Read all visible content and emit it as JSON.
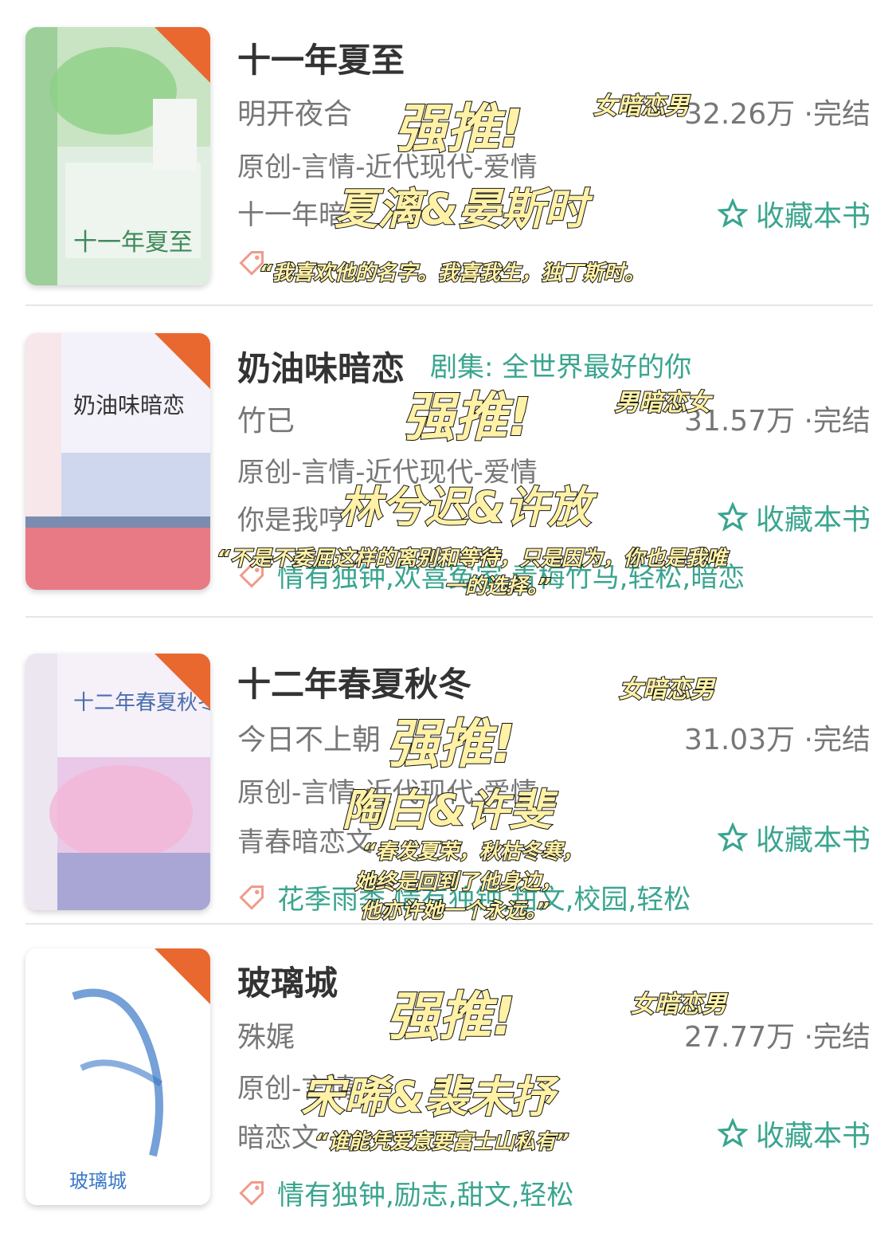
{
  "books": [
    {
      "title": "十一年夏至",
      "author": "明开夜合",
      "stats": "32.26万 ·完结",
      "genre": "原创-言情-近代现代-爱情",
      "intro": "十一年暗",
      "fav_label": "收藏本书",
      "badge": "完结",
      "cover_text": "十一年夏至"
    },
    {
      "title": "奶油味暗恋",
      "drama": "剧集: 全世界最好的你",
      "author": "竹已",
      "stats": "31.57万 ·完结",
      "genre": "原创-言情-近代现代-爱情",
      "intro": "你是我哼",
      "fav_label": "收藏本书",
      "tags": "情有独钟,欢喜冤家,青梅竹马,轻松,暗恋",
      "badge": "完结",
      "cover_text": "奶油味暗恋"
    },
    {
      "title": "十二年春夏秋冬",
      "author": "今日不上朝",
      "stats": "31.03万 ·完结",
      "genre": "原创-言情-近代现代-爱情",
      "intro": "青春暗恋文",
      "fav_label": "收藏本书",
      "tags": "花季雨季,情有独钟,甜文,校园,轻松",
      "badge": "完结",
      "cover_text": "十二年春夏秋冬"
    },
    {
      "title": "玻璃城",
      "author": "殊娓",
      "stats": "27.77万 ·完结",
      "genre": "原创-言情",
      "intro": "暗恋文",
      "fav_label": "收藏本书",
      "tags": "情有独钟,励志,甜文,轻松",
      "badge": "完结",
      "cover_text": "玻璃城"
    }
  ],
  "overlays": [
    {
      "recommend": "强推!",
      "type": "女暗恋男",
      "names": "夏漓&晏斯时",
      "quote": "“我喜欢他的名字。我喜我生，独丁斯时。"
    },
    {
      "recommend": "强推!",
      "type": "男暗恋女",
      "names": "林兮迟&许放",
      "quote1": "“不是不委屈这样的离别和等待，只是因为，你也是我唯",
      "quote2": "一的选择。”"
    },
    {
      "recommend": "强推!",
      "type": "女暗恋男",
      "names": "陶白&许斐",
      "quote1": "“春发夏荣，秋枯冬寒，",
      "quote2": "她终是回到了他身边，",
      "quote3": "他亦许她一个永远。”"
    },
    {
      "recommend": "强推!",
      "type": "女暗恋男",
      "names": "宋晞&裴未抒",
      "quote": "“谁能凭爱意要富士山私有”"
    }
  ],
  "colors": {
    "accent": "#3aa58f",
    "badge": "#e8682f",
    "overlay_fill": "#fff1a6"
  }
}
